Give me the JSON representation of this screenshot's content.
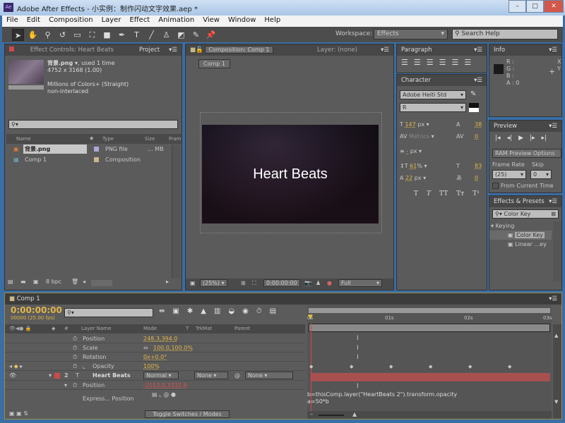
{
  "window": {
    "title": "Adobe After Effects - 小实例：制作闪动文字效果.aep *",
    "app_icon": "Ae",
    "minimize": "–",
    "maximize": "□",
    "close": "✕"
  },
  "menu": [
    "File",
    "Edit",
    "Composition",
    "Layer",
    "Effect",
    "Animation",
    "View",
    "Window",
    "Help"
  ],
  "toolbar": {
    "tools": [
      "selection-tool",
      "hand-tool",
      "zoom-tool",
      "rotate-tool",
      "camera-tool",
      "pan-behind-tool",
      "rectangle-tool",
      "pen-tool",
      "type-tool",
      "brush-tool",
      "clone-stamp-tool",
      "eraser-tool",
      "roto-brush-tool",
      "puppet-pin-tool"
    ],
    "workspace_label": "Workspace:",
    "workspace_value": "Effects",
    "search_placeholder": "Search Help"
  },
  "project": {
    "tab_effect_controls": "Effect Controls: Heart Beats",
    "tab_project": "Project",
    "asset_name": "背景.png ▾",
    "asset_used": ", used 1 time",
    "asset_dims": "4752 x 3168 (1.00)",
    "asset_colors": "Millions of Colors+ (Straight)",
    "asset_interlace": "non-interlaced",
    "columns": [
      "Name",
      "Type",
      "Size",
      "Fram"
    ],
    "items": [
      {
        "name": "背景.png",
        "type": "PNG file",
        "size": "... MB",
        "label_color": "#a9a9d9"
      },
      {
        "name": "Comp 1",
        "type": "Composition",
        "size": "",
        "label_color": "#c8b88a"
      }
    ],
    "bpc": "8 bpc"
  },
  "composition": {
    "tab": "Composition: Comp 1",
    "layer_tab": "Layer: (none)",
    "breadcrumb": "Comp 1",
    "text": "Heart Beats",
    "zoom": "(25%)",
    "timecode": "0:00:00:00",
    "resolution": "Full"
  },
  "paragraph": {
    "title": "Paragraph"
  },
  "character": {
    "title": "Character",
    "font": "Adobe Heiti Std",
    "style": "R",
    "font_size": "147",
    "font_size_unit": "px",
    "leading": "38",
    "kerning": "Metrics",
    "tracking": "0",
    "stroke_width": "-",
    "stroke_unit": "px",
    "vert_scale": "61",
    "horiz_scale": "83",
    "baseline_shift": "22",
    "tsume": "0",
    "percent": "%",
    "px": "px",
    "styles": [
      "T",
      "T",
      "TT",
      "Tт",
      "T¹"
    ]
  },
  "info": {
    "title": "Info",
    "r": "R :",
    "g": "G :",
    "b": "B :",
    "a": "A : 0",
    "x": "X",
    "y": "Y"
  },
  "preview": {
    "title": "Preview",
    "ram_options": "RAM Preview Options",
    "frame_rate_label": "Frame Rate",
    "skip_label": "Skip",
    "frame_rate": "(25)",
    "skip": "0",
    "from_current": "From Current Time"
  },
  "effects": {
    "title": "Effects & Presets",
    "search": "Color Key",
    "category": "Keying",
    "items": [
      "Color Key",
      "Linear ...ey"
    ]
  },
  "timeline": {
    "tab": "Comp 1",
    "timecode": "0:00:00:00",
    "fps": "00000 (25.00 fps)",
    "columns": {
      "layer_name": "Layer Name",
      "mode": "Mode",
      "t": "T",
      "trkmat": "TrkMat",
      "parent": "Parent"
    },
    "rows": [
      {
        "name": "Position",
        "value": "248.3,394.0"
      },
      {
        "name": "Scale",
        "value": "100.0,100.0%"
      },
      {
        "name": "Rotation",
        "value": "0x+0.0°"
      },
      {
        "name": "Opacity",
        "value": "100%"
      }
    ],
    "layer": {
      "num": "2",
      "name": "Heart Beats",
      "mode": "Normal",
      "trkmat": "None",
      "parent": "None",
      "color": "#d04848"
    },
    "layer_position": {
      "name": "Position",
      "value": "-2013.0,3332.8"
    },
    "expression_label": "Express... Position",
    "expression_code": [
      "b=thisComp.layer(\"HeartBeats 2\").transform.opacity",
      "a=50*b"
    ],
    "ruler": [
      "0s",
      "01s",
      "02s",
      "03s"
    ],
    "toggle": "Toggle Switches / Modes"
  }
}
